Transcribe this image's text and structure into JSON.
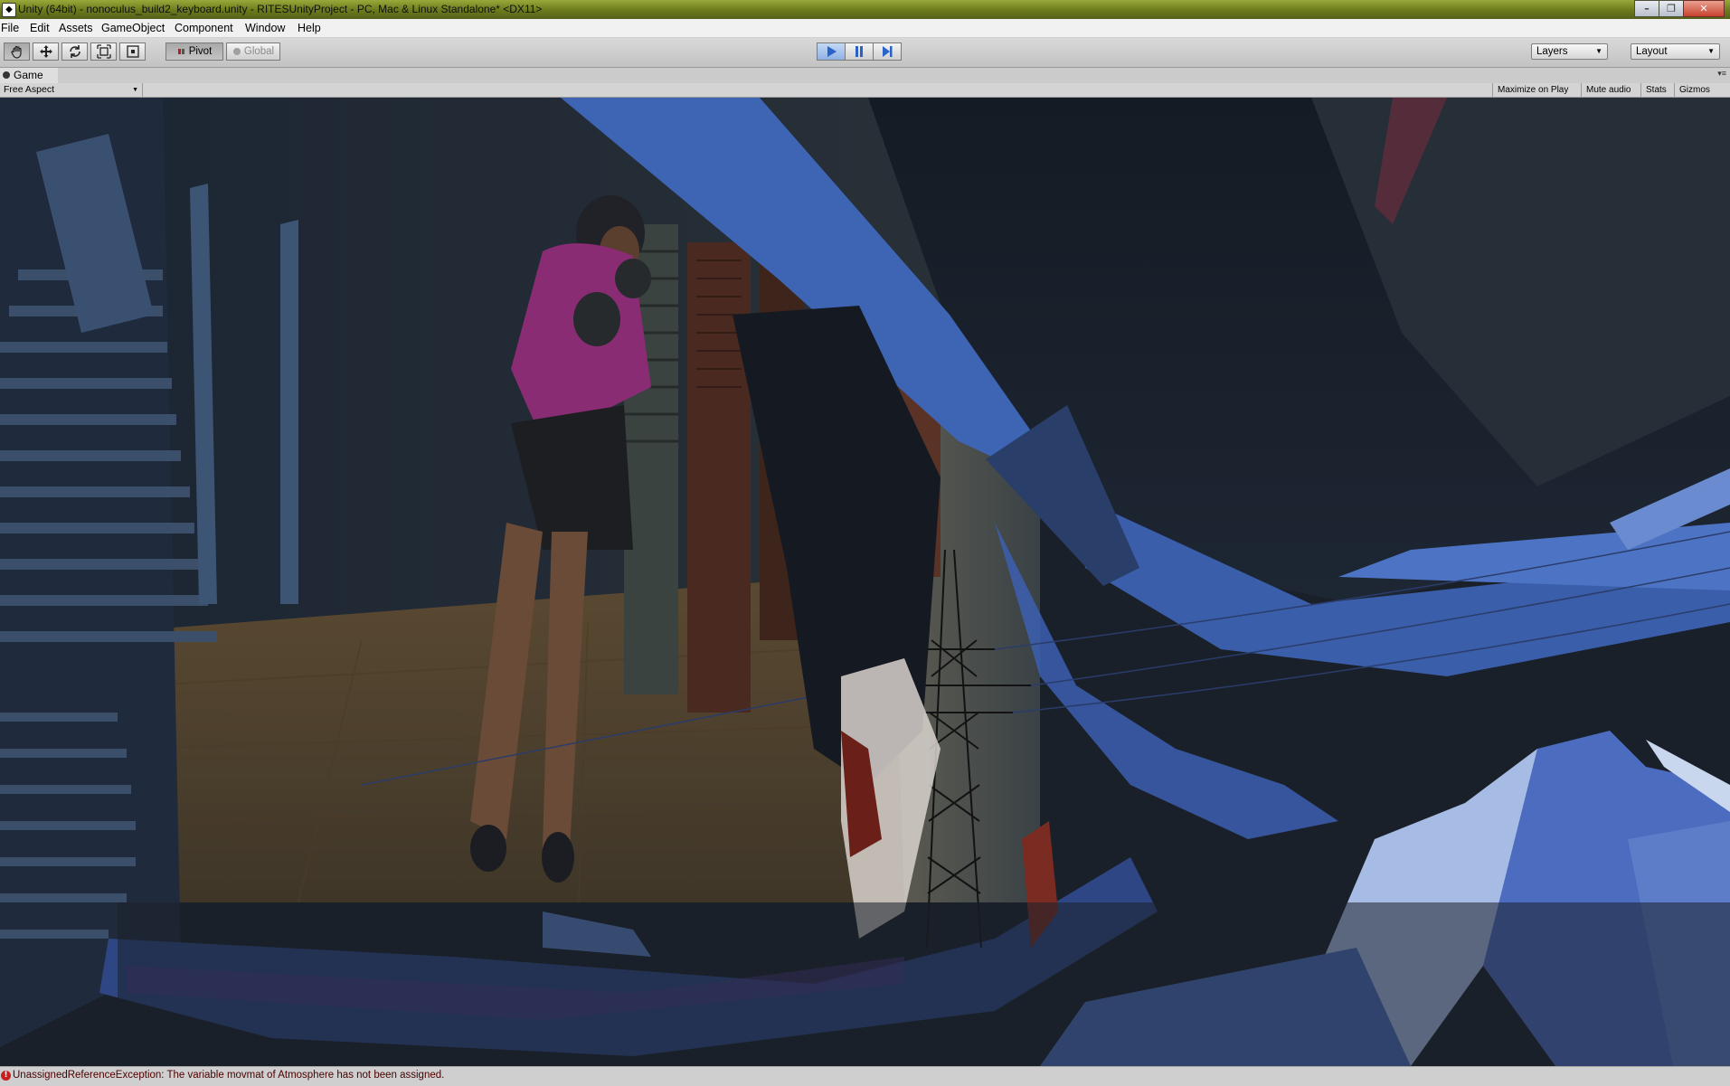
{
  "window": {
    "title": "Unity (64bit) - nonoculus_build2_keyboard.unity - RITESUnityProject - PC, Mac & Linux Standalone* <DX11>"
  },
  "menu": [
    "File",
    "Edit",
    "Assets",
    "GameObject",
    "Component",
    "Window",
    "Help"
  ],
  "toolbar": {
    "pivot_label": "Pivot",
    "global_label": "Global",
    "layers_label": "Layers",
    "layout_label": "Layout"
  },
  "game_tab": {
    "label": "Game",
    "aspect": "Free Aspect",
    "maximize_label": "Maximize on Play",
    "mute_label": "Mute audio",
    "stats_label": "Stats",
    "gizmos_label": "Gizmos"
  },
  "status": {
    "message": "UnassignedReferenceException: The variable movmat of Atmosphere has not been assigned."
  },
  "colors": {
    "play_accent": "#3a78d8",
    "error_red": "#c81e1e",
    "scene_blue": "#3e64b4"
  }
}
